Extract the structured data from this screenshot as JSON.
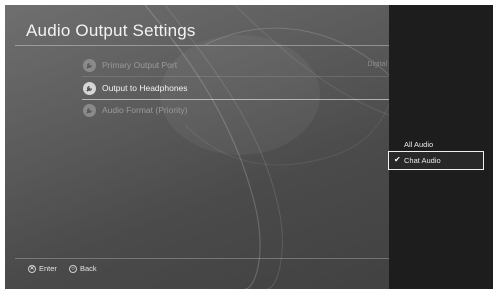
{
  "header": {
    "title": "Audio Output Settings"
  },
  "menu": {
    "items": [
      {
        "label": "Primary Output Port",
        "value": "Digital",
        "icon": "wrench-icon",
        "state": "dimmed"
      },
      {
        "label": "Output to Headphones",
        "value": "",
        "icon": "wrench-icon",
        "state": "selected"
      },
      {
        "label": "Audio Format (Priority)",
        "value": "",
        "icon": "wrench-icon",
        "state": "dimmed"
      }
    ]
  },
  "options_panel": {
    "options": [
      {
        "label": "All Audio",
        "checked": false,
        "focused": false
      },
      {
        "label": "Chat Audio",
        "checked": true,
        "focused": true
      }
    ],
    "check_glyph": "✔"
  },
  "footer": {
    "enter_label": "Enter",
    "enter_glyph": "✕",
    "back_label": "Back",
    "back_glyph": "○"
  }
}
